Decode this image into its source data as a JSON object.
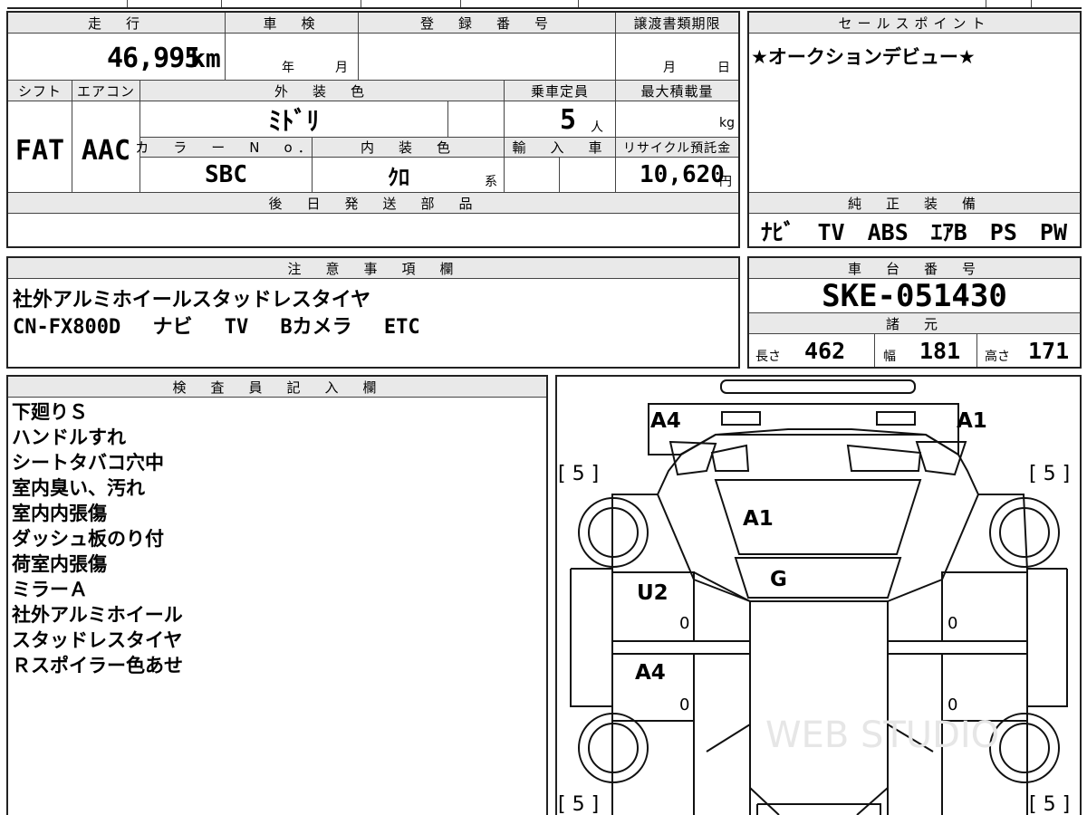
{
  "top_info": {
    "headers": {
      "mileage": "走　行",
      "inspection": "車　検",
      "registration": "登　録　番　号",
      "transfer_deadline": "譲渡書類期限",
      "sales_point": "セールスポイント"
    },
    "mileage_value": "46,995",
    "mileage_unit": "km",
    "inspection_year": "年",
    "inspection_month": "月",
    "deadline_month": "月",
    "deadline_day": "日"
  },
  "spec": {
    "headers": {
      "shift": "シフト",
      "aircon": "エアコン",
      "exterior_color": "外　装　色",
      "capacity": "乗車定員",
      "max_load": "最大積載量",
      "color_no": "カ　ラ　ー　N　o．",
      "interior_color": "内　装　色",
      "import": "輸　入　車",
      "recycle": "リサイクル預託金"
    },
    "shift": "FAT",
    "aircon": "AAC",
    "exterior_color": "ﾐﾄﾞﾘ",
    "capacity": "5",
    "capacity_unit": "人",
    "max_load_unit": "kg",
    "color_no": "SBC",
    "interior_color": "ｸﾛ",
    "interior_suffix": "系",
    "recycle_fee": "10,620",
    "recycle_unit": "円"
  },
  "sales_point": {
    "text": "★オークションデビュー★"
  },
  "later_parts": {
    "header": "後　日　発　送　部　品"
  },
  "genuine_equipment": {
    "header": "純　正　装　備",
    "items": "ﾅﾋﾞ　TV　ABS　ｴｱB　PS　PW"
  },
  "notes": {
    "header": "注　意　事　項　欄",
    "lines": [
      "社外アルミホイールスタッドレスタイヤ",
      "CN-FX800D　 ナビ　 TV　 Bカメラ　 ETC"
    ]
  },
  "chassis": {
    "header": "車　台　番　号",
    "number": "SKE-051430"
  },
  "dimensions": {
    "header": "諸　元",
    "length_label": "長さ",
    "length": "462",
    "width_label": "幅",
    "width": "181",
    "height_label": "高さ",
    "height": "171"
  },
  "inspector": {
    "header": "検　査　員　記　入　欄",
    "lines": [
      "下廻りＳ",
      "ハンドルすれ",
      "シートタバコ穴中",
      "室内臭い、汚れ",
      "室内内張傷",
      "ダッシュ板のり付",
      "荷室内張傷",
      "ミラーＡ",
      "社外アルミホイール",
      "スタッドレスタイヤ",
      "Ｒスポイラー色あせ"
    ]
  },
  "diagram": {
    "marks": {
      "front_left": "A4",
      "front_right": "A1",
      "windshield": "A1",
      "hood": "G",
      "left_front_door": "U2",
      "left_rear_door": "A4"
    },
    "tire_labels": [
      "[ 5 ]",
      "[ 5 ]",
      "[ 5 ]",
      "[ 5 ]"
    ],
    "door_values": [
      "0",
      "0",
      "0",
      "0"
    ],
    "watermark": "WEB STUDIO"
  }
}
